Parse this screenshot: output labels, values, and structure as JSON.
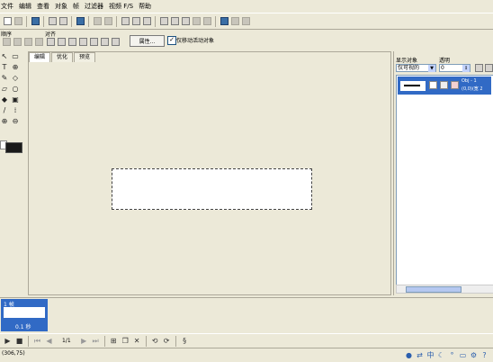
{
  "menu": [
    "文件",
    "编辑",
    "查看",
    "对象",
    "帧",
    "过滤器",
    "视频 F/S",
    "帮助"
  ],
  "toolbar2": {
    "order_label": "顺序",
    "align_label": "对齐",
    "properties_button": "属性...",
    "only_move_active": "仅移动活动对象",
    "only_move_active_checked": true
  },
  "canvas_tabs": [
    "编辑",
    "优化",
    "预览"
  ],
  "canvas_active_tab": "编辑",
  "right_panel": {
    "show_objects_label": "显示对象",
    "opacity_label": "透明",
    "show_objects_value": "仅可视的",
    "opacity_value": "0",
    "layer_text_1": "Obj - 1",
    "layer_text_2": "(0,0)(宽 2"
  },
  "timeline": {
    "frame_number": "1 帧",
    "frame_delay": "0.1 秒"
  },
  "playback": {
    "frame_counter": "1/1"
  },
  "status": {
    "coordinates": "(306,75)"
  },
  "colors": {
    "background": "#ece9d8",
    "selection": "#316ac5",
    "foreground_color": "#1a1a1a"
  }
}
